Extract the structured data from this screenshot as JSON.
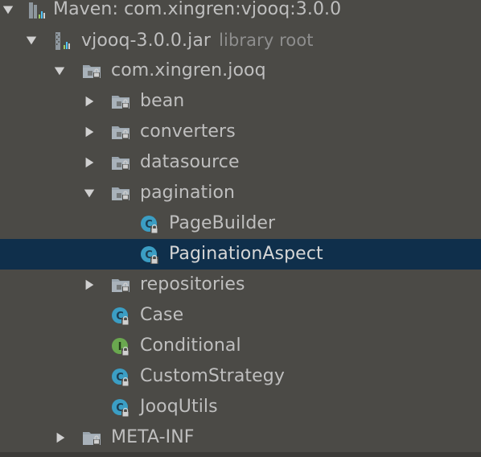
{
  "colors": {
    "background": "#4b4a46",
    "selection": "#0f2f4b",
    "text": "#bfbfbf",
    "muted_text": "#8e8e8e",
    "class_icon": "#3b9ec4",
    "interface_icon": "#6aa84f",
    "folder_icon": "#a9b2ba"
  },
  "tree": {
    "root": {
      "label": "Maven: com.xingren:vjooq:3.0.0",
      "icon": "library-icon",
      "expanded": true
    },
    "jar": {
      "label": "vjooq-3.0.0.jar",
      "suffix": "library root",
      "icon": "jar-icon",
      "expanded": true
    },
    "package": {
      "label": "com.xingren.jooq",
      "icon": "package-icon",
      "expanded": true
    },
    "bean": {
      "label": "bean",
      "icon": "package-icon",
      "expanded": false
    },
    "converters": {
      "label": "converters",
      "icon": "package-icon",
      "expanded": false
    },
    "datasource": {
      "label": "datasource",
      "icon": "package-icon",
      "expanded": false
    },
    "pagination": {
      "label": "pagination",
      "icon": "package-icon",
      "expanded": true
    },
    "page_builder": {
      "label": "PageBuilder",
      "icon": "class-icon"
    },
    "pagination_aspect": {
      "label": "PaginationAspect",
      "icon": "class-icon",
      "selected": true
    },
    "repositories": {
      "label": "repositories",
      "icon": "package-icon",
      "expanded": false
    },
    "case": {
      "label": "Case",
      "icon": "class-icon"
    },
    "conditional": {
      "label": "Conditional",
      "icon": "interface-icon"
    },
    "custom_strategy": {
      "label": "CustomStrategy",
      "icon": "class-icon"
    },
    "jooq_utils": {
      "label": "JooqUtils",
      "icon": "class-icon"
    },
    "meta_inf": {
      "label": "META-INF",
      "icon": "folder-icon",
      "expanded": false
    }
  }
}
